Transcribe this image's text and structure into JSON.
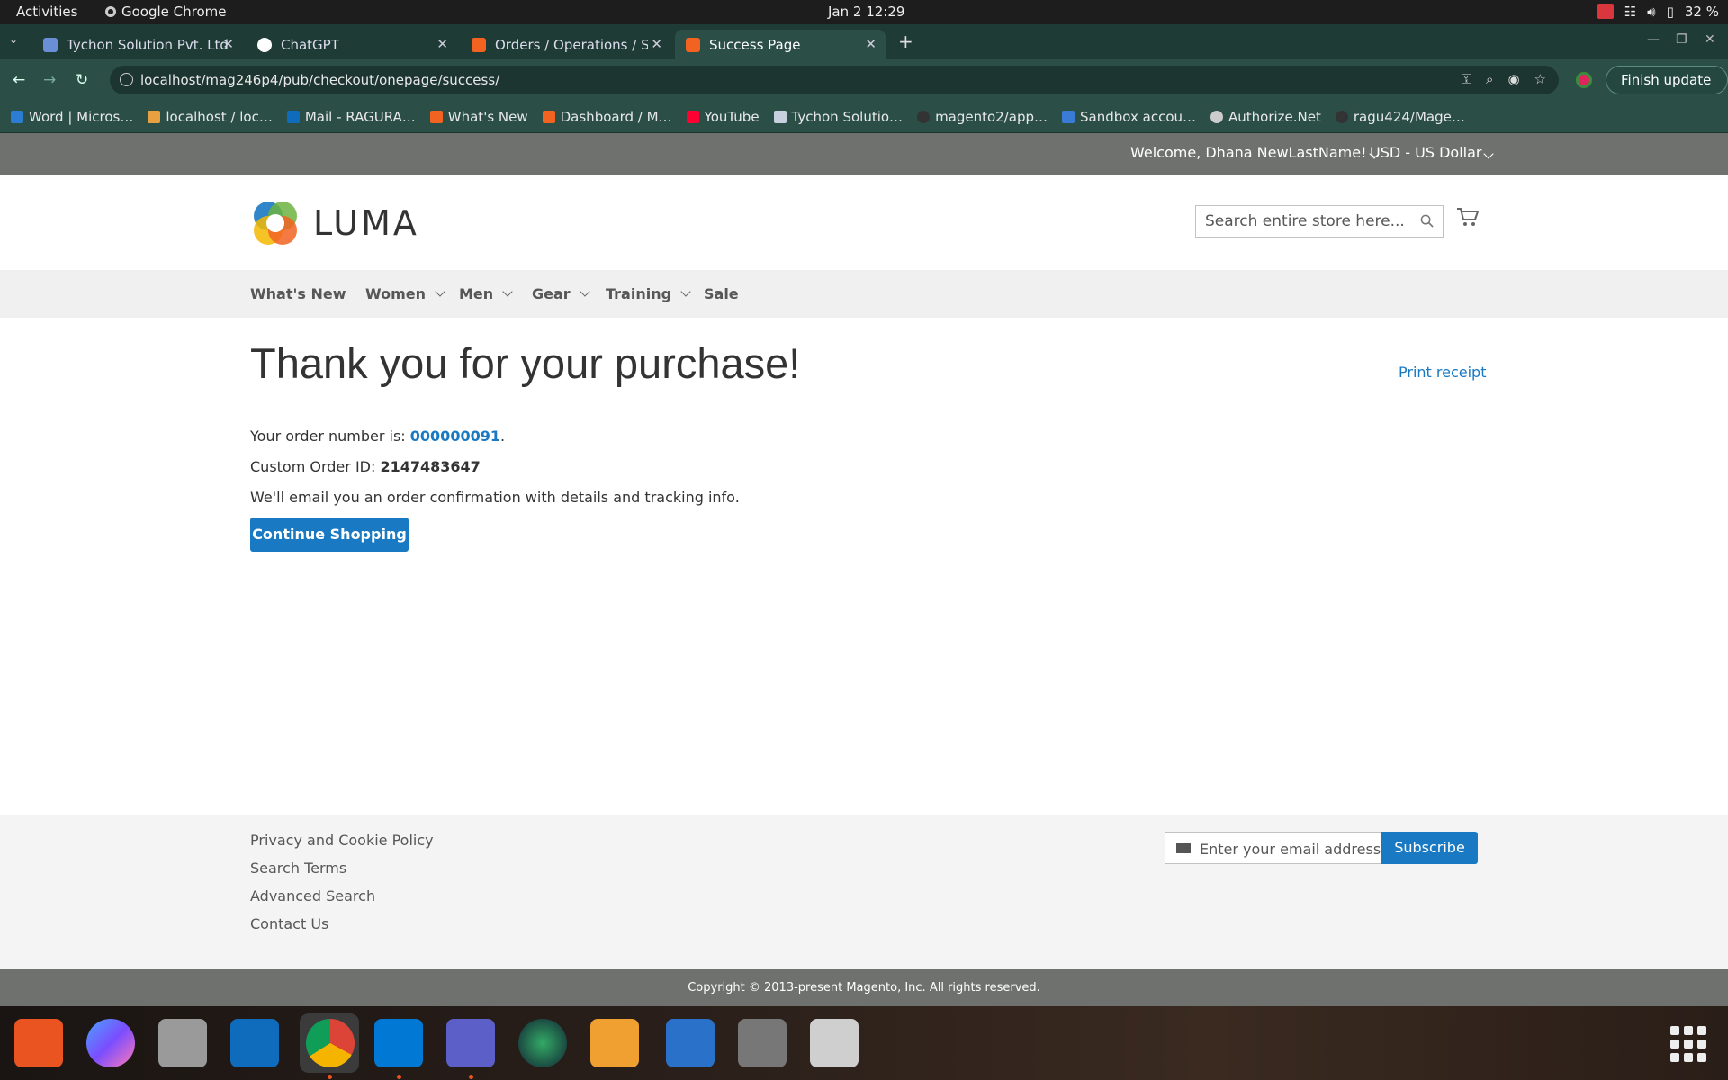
{
  "system": {
    "activities": "Activities",
    "app_name": "Google Chrome",
    "clock": "Jan 2  12:29",
    "battery": "32 %"
  },
  "browser": {
    "tabs": [
      {
        "title": "Tychon Solution Pvt. Ltd"
      },
      {
        "title": "ChatGPT"
      },
      {
        "title": "Orders / Operations / Sa"
      },
      {
        "title": "Success Page"
      }
    ],
    "url": "localhost/mag246p4/pub/checkout/onepage/success/",
    "finish_update": "Finish update",
    "bookmarks": [
      "Word | Micros…",
      "localhost / loc…",
      "Mail - RAGURA…",
      "What's New",
      "Dashboard / M…",
      "YouTube",
      "Tychon Solutio…",
      "magento2/app…",
      "Sandbox accou…",
      "Authorize.Net",
      "ragu424/Mage…"
    ]
  },
  "store": {
    "welcome": "Welcome, Dhana NewLastName!",
    "currency": "USD - US Dollar",
    "logo_text": "LUMA",
    "search_placeholder": "Search entire store here...",
    "nav": [
      "What's New",
      "Women",
      "Men",
      "Gear",
      "Training",
      "Sale"
    ],
    "page_title": "Thank you for your purchase!",
    "print_receipt": "Print receipt",
    "order_label": "Your order number is: ",
    "order_number": "000000091",
    "order_suffix": ".",
    "custom_label": "Custom Order ID: ",
    "custom_id": "2147483647",
    "email_note": "We'll email you an order confirmation with details and tracking info.",
    "continue_label": "Continue Shopping",
    "footer_links": [
      "Privacy and Cookie Policy",
      "Search Terms",
      "Advanced Search",
      "Contact Us"
    ],
    "newsletter_placeholder": "Enter your email address",
    "subscribe_label": "Subscribe",
    "copyright": "Copyright © 2013-present Magento, Inc. All rights reserved."
  },
  "colors": {
    "accent": "#1979c3",
    "panel": "#6e716e",
    "chrome_toolbar": "#2b4f47"
  }
}
